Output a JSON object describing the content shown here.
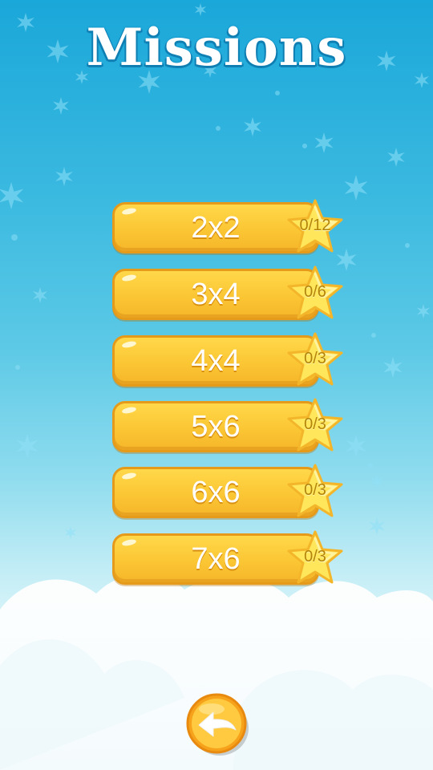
{
  "title": "Missions",
  "missions": [
    {
      "label": "2x2",
      "progress": "0/12"
    },
    {
      "label": "3x4",
      "progress": "0/6"
    },
    {
      "label": "4x4",
      "progress": "0/3"
    },
    {
      "label": "5x6",
      "progress": "0/3"
    },
    {
      "label": "6x6",
      "progress": "0/3"
    },
    {
      "label": "7x6",
      "progress": "0/3"
    }
  ],
  "back_icon": "back-arrow-icon",
  "colors": {
    "sky_top": "#1aa7d9",
    "button_yellow": "#fbc634",
    "button_border": "#e69a1a",
    "star_yellow": "#ffe65a",
    "back_orange": "#f7a21b"
  }
}
